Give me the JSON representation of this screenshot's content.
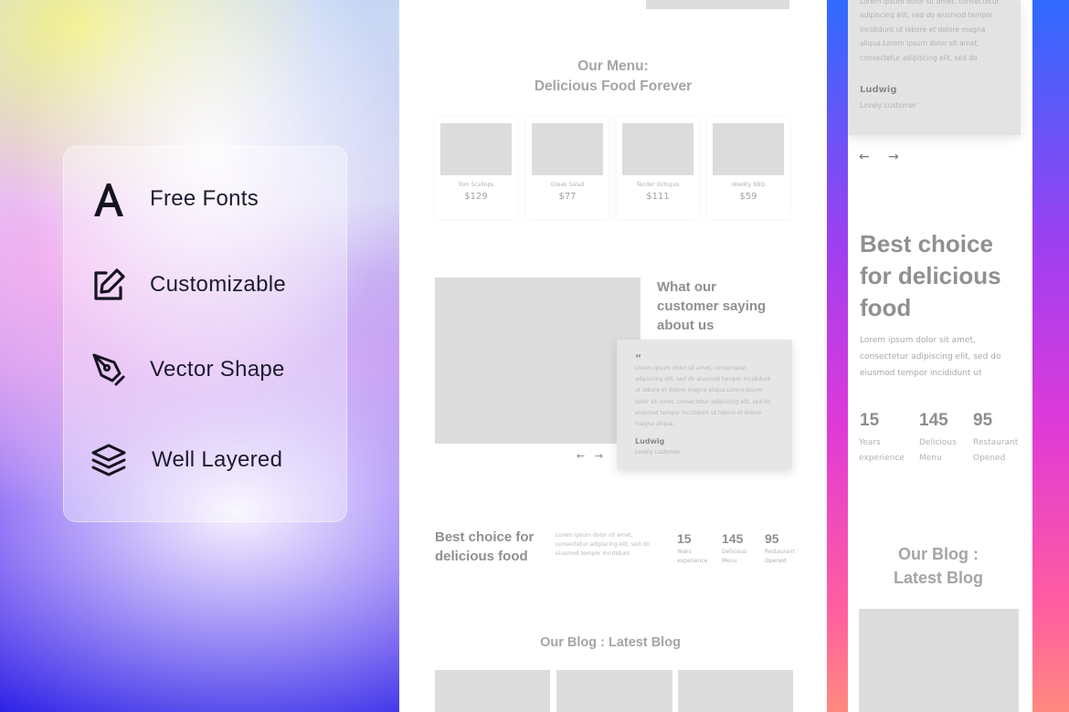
{
  "features": [
    {
      "icon": "letter-a-icon",
      "label": "Free Fonts"
    },
    {
      "icon": "edit-icon",
      "label": "Customizable"
    },
    {
      "icon": "pen-tool-icon",
      "label": "Vector Shape"
    },
    {
      "icon": "layers-icon",
      "label": "Well Layered"
    }
  ],
  "desktop": {
    "menu_heading": [
      "Our Menu:",
      "Delicious Food Forever"
    ],
    "menu_items": [
      {
        "name": "Tom Scallops",
        "price": "$129"
      },
      {
        "name": "Greek Salad",
        "price": "$77"
      },
      {
        "name": "Tender Octopus",
        "price": "$111"
      },
      {
        "name": "Weekly BBQ",
        "price": "$59"
      }
    ],
    "testimonial": {
      "heading": [
        "What our",
        "customer saying",
        "about us"
      ],
      "quote_mark": "“",
      "body": "Lorem ipsum dolor sit amet, consectetur adipiscing elit, sed do eiusmod tempor incididunt ut labore et dolore magna aliqua.Lorem ipsum dolor sit amet, consectetur adipiscing elit, sed do eiusmod tempor incididunt ut labore et dolore magna aliqua.",
      "name": "Ludwig",
      "role": "Lovely customer",
      "prev": "←",
      "next": "→"
    },
    "best": {
      "heading": [
        "Best choice for",
        "delicious food"
      ],
      "body": "Lorem ipsum dolor sit amet, consectetur adipiscing elit, sed do eiusmod tempor incididunt",
      "stats": [
        {
          "num": "15",
          "label": [
            "Years",
            "experience"
          ]
        },
        {
          "num": "145",
          "label": [
            "Delicious",
            "Menu"
          ]
        },
        {
          "num": "95",
          "label": [
            "Restaurant",
            "Opened"
          ]
        }
      ]
    },
    "blog_heading": "Our Blog : Latest Blog"
  },
  "mobile": {
    "quote_body": [
      "Lorem ipsum dolor sit amet, consectetur",
      "adipiscing elit, sed do eiusmod tempor",
      "incididunt ut labore et dolore magna",
      "aliqua.Lorem ipsum dolor sit amet,",
      "consectetur adipiscing elit, sed do"
    ],
    "name": "Ludwig",
    "role": "Lovely customer",
    "prev": "←",
    "next": "→",
    "best_heading": [
      "Best choice",
      "for delicious",
      "food"
    ],
    "best_body": [
      "Lorem ipsum dolor sit amet,",
      "consectetur adipiscing elit, sed do",
      "eiusmod tempor incididunt ut"
    ],
    "stats": [
      {
        "num": "15",
        "label": [
          "Years",
          "experience"
        ]
      },
      {
        "num": "145",
        "label": [
          "Delicious",
          "Menu"
        ]
      },
      {
        "num": "95",
        "label": [
          "Restaurant",
          "Opened"
        ]
      }
    ],
    "blog_heading": [
      "Our Blog :",
      "Latest Blog"
    ]
  }
}
